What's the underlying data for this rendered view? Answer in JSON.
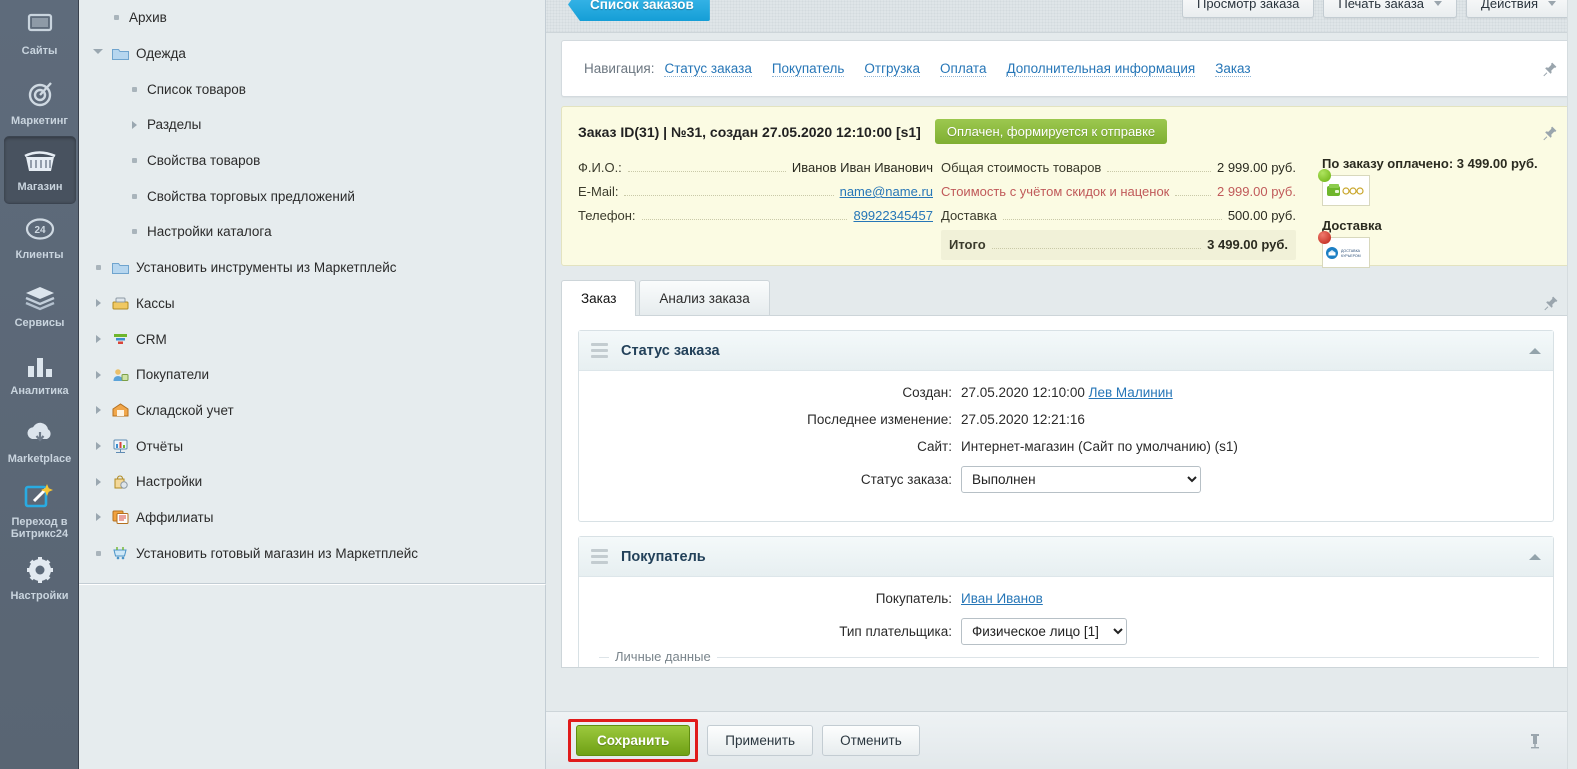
{
  "rail": {
    "items": [
      {
        "label": "Сайты",
        "icon": "sites-icon",
        "active": false
      },
      {
        "label": "Маркетинг",
        "icon": "target-icon",
        "active": false
      },
      {
        "label": "Магазин",
        "icon": "basket-icon",
        "active": true
      },
      {
        "label": "Клиенты",
        "icon": "badge24-icon",
        "active": false
      },
      {
        "label": "Сервисы",
        "icon": "layers-icon",
        "active": false
      },
      {
        "label": "Аналитика",
        "icon": "bar-chart-icon",
        "active": false
      },
      {
        "label": "Marketplace",
        "icon": "cloud-download-icon",
        "active": false
      },
      {
        "label": "Переход в\nБитрикс24",
        "icon": "magic-wand-icon",
        "active": false
      },
      {
        "label": "Настройки",
        "icon": "gear-icon",
        "active": false
      }
    ]
  },
  "tree": {
    "nodes": [
      {
        "label": "Архив",
        "indent": 1,
        "marker": "dot",
        "icon": "none"
      },
      {
        "label": "Одежда",
        "indent": 0,
        "marker": "expanded",
        "icon": "folder-icon"
      },
      {
        "label": "Список товаров",
        "indent": 2,
        "marker": "dot",
        "icon": "none"
      },
      {
        "label": "Разделы",
        "indent": 2,
        "marker": "collapsed",
        "icon": "none"
      },
      {
        "label": "Свойства товаров",
        "indent": 2,
        "marker": "dot",
        "icon": "none"
      },
      {
        "label": "Свойства торговых предложений",
        "indent": 2,
        "marker": "dot",
        "icon": "none"
      },
      {
        "label": "Настройки каталога",
        "indent": 2,
        "marker": "dot",
        "icon": "none"
      },
      {
        "label": "Установить инструменты из Маркетплейс",
        "indent": 0,
        "marker": "dot",
        "icon": "folder-icon"
      },
      {
        "label": "Кассы",
        "indent": 0,
        "marker": "collapsed",
        "icon": "cashbox-icon"
      },
      {
        "label": "CRM",
        "indent": 0,
        "marker": "collapsed",
        "icon": "funnel-icon"
      },
      {
        "label": "Покупатели",
        "indent": 0,
        "marker": "collapsed",
        "icon": "user-lock-icon"
      },
      {
        "label": "Складской учет",
        "indent": 0,
        "marker": "collapsed",
        "icon": "warehouse-icon"
      },
      {
        "label": "Отчёты",
        "indent": 0,
        "marker": "collapsed",
        "icon": "report-icon"
      },
      {
        "label": "Настройки",
        "indent": 0,
        "marker": "collapsed",
        "icon": "settings-bag-icon"
      },
      {
        "label": "Аффилиаты",
        "indent": 0,
        "marker": "collapsed",
        "icon": "affiliate-icon"
      },
      {
        "label": "Установить готовый магазин из Маркетплейс",
        "indent": 0,
        "marker": "dot",
        "icon": "shop-cart-icon"
      }
    ]
  },
  "toolbar": {
    "back_tab": "Список заказов",
    "buttons": [
      {
        "label": "Просмотр заказа",
        "has_caret": false
      },
      {
        "label": "Печать заказа",
        "has_caret": true
      },
      {
        "label": "Действия",
        "has_caret": true
      }
    ]
  },
  "navigation": {
    "label": "Навигация:",
    "links": [
      "Статус заказа",
      "Покупатель",
      "Отгрузка",
      "Оплата",
      "Дополнительная информация",
      "Заказ"
    ]
  },
  "summary": {
    "title": "Заказ ID(31) | №31, создан 27.05.2020 12:10:00 [s1]",
    "status_badge": "Оплачен, формируется к отправке",
    "customer": {
      "fio_label": "Ф.И.О.:",
      "fio_value": "Иванов Иван Иванович",
      "email_label": "E-Mail:",
      "email_value": "name@name.ru",
      "phone_label": "Телефон:",
      "phone_value": "89922345457"
    },
    "totals": [
      {
        "label": "Общая стоимость товаров",
        "value": "2 999.00 руб.",
        "discount": false,
        "total": false
      },
      {
        "label": "Стоимость с учётом скидок и наценок",
        "value": "2 999.00 руб.",
        "discount": true,
        "total": false
      },
      {
        "label": "Доставка",
        "value": "500.00 руб.",
        "discount": false,
        "total": false
      },
      {
        "label": "Итого",
        "value": "3 499.00 руб.",
        "discount": false,
        "total": true
      }
    ],
    "paid_title": "По заказу оплачено: 3 499.00 руб.",
    "paid_icon_caption": "wallet-icon",
    "paid_status": "green",
    "delivery_title": "Доставка",
    "delivery_icon_caption": "ДОСТАВКА КУРЬЕРОМ",
    "delivery_status": "red"
  },
  "tabs": [
    {
      "label": "Заказ",
      "active": true
    },
    {
      "label": "Анализ заказа",
      "active": false
    }
  ],
  "sections": [
    {
      "title": "Статус заказа",
      "fields": [
        {
          "label": "Создан:",
          "type": "text-link",
          "value": "27.05.2020 12:10:00 ",
          "link": "Лев Малинин"
        },
        {
          "label": "Последнее изменение:",
          "type": "text",
          "value": "27.05.2020 12:21:16"
        },
        {
          "label": "Сайт:",
          "type": "text",
          "value": "Интернет-магазин (Сайт по умолчанию) (s1)"
        },
        {
          "label": "Статус заказа:",
          "type": "select",
          "value": "Выполнен",
          "options": [
            "Выполнен"
          ]
        }
      ]
    },
    {
      "title": "Покупатель",
      "fields": [
        {
          "label": "Покупатель:",
          "type": "link",
          "value": "Иван Иванов"
        },
        {
          "label": "Тип плательщика:",
          "type": "select",
          "value": "Физическое лицо [1]",
          "options": [
            "Физическое лицо [1]"
          ]
        }
      ],
      "fieldset_legend": "Личные данные"
    }
  ],
  "bottom_bar": {
    "save": "Сохранить",
    "apply": "Применить",
    "cancel": "Отменить",
    "highlight_color": "#e01b1b"
  },
  "colors": {
    "accent_blue": "#29abe2",
    "link_blue": "#2676b7",
    "status_green": "#8cba3f",
    "save_green": "#7fb122",
    "summary_bg": "#fbfbe3",
    "discount_red": "#c05a5a",
    "rail_bg": "#5d6a7a",
    "tree_bg": "#e6ecee"
  }
}
